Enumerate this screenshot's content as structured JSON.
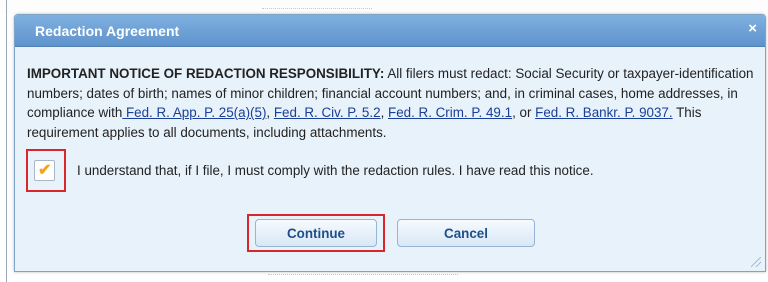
{
  "dialog": {
    "title": "Redaction Agreement",
    "close_symbol": "×"
  },
  "notice": {
    "heading": "IMPORTANT NOTICE OF REDACTION RESPONSIBILITY:",
    "text_part1": " All filers must redact: Social Security or taxpayer-identification numbers; dates of birth; names of minor children; financial account numbers; and, in criminal cases, home addresses, in compliance with",
    "link1": " Fed. R. App. P. 25(a)(5)",
    "sep1": ", ",
    "link2": "Fed. R. Civ. P. 5.2",
    "sep2": ", ",
    "link3": "Fed. R. Crim. P. 49.1",
    "sep3": ", or ",
    "link4": "Fed. R. Bankr. P. 9037.",
    "text_part2": " This requirement applies to all documents, including attachments."
  },
  "agreement": {
    "checked": true,
    "check_symbol": "✔",
    "label": "I understand that, if I file, I must comply with the redaction rules. I have read this notice."
  },
  "buttons": {
    "continue_label": "Continue",
    "cancel_label": "Cancel"
  },
  "colors": {
    "titlebar": "#6a9fd6",
    "dialog_bg": "#e8f2fb",
    "highlight": "#d9262a",
    "checkmark": "#f2a518",
    "link": "#1a3f9a"
  }
}
